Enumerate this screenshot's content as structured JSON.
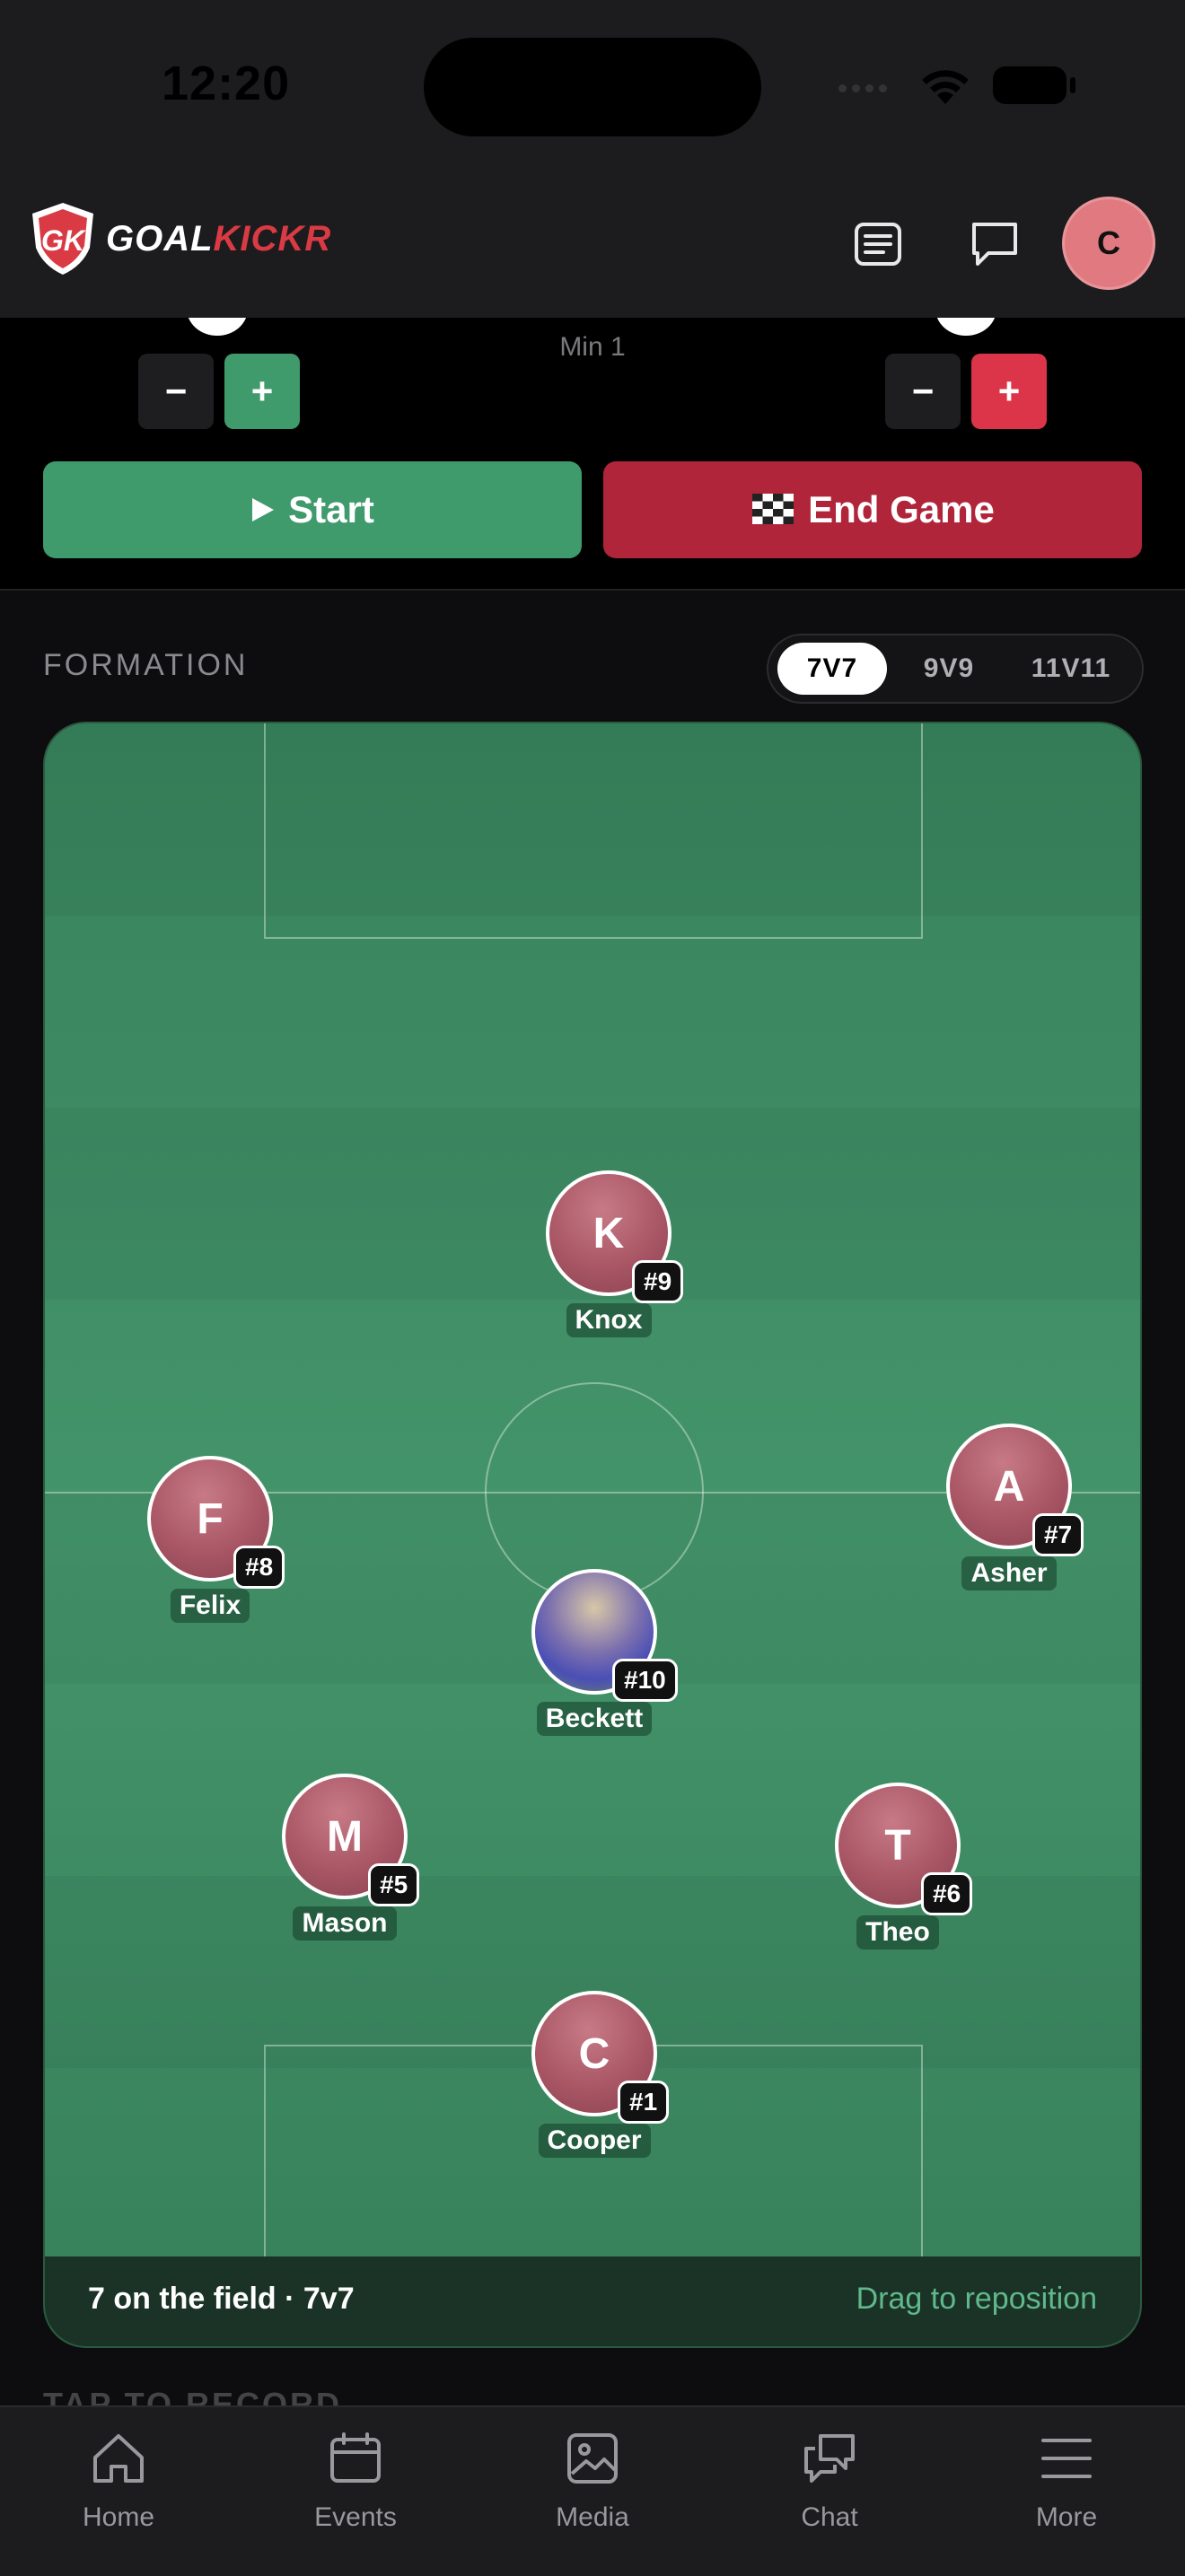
{
  "status_bar": {
    "time": "12:20"
  },
  "header": {
    "brand_part1": "GOAL",
    "brand_part2": "KICKR",
    "avatar_initial": "C"
  },
  "scoreboard": {
    "minute_label": "Min 1",
    "minus_label": "−",
    "plus_label": "+",
    "start_label": "Start",
    "end_label": "End Game"
  },
  "formation": {
    "label": "FORMATION",
    "options": [
      "7V7",
      "9V9",
      "11V11"
    ],
    "selected": "7V7"
  },
  "players": [
    {
      "initial": "K",
      "number": "#9",
      "name": "Knox"
    },
    {
      "initial": "F",
      "number": "#8",
      "name": "Felix"
    },
    {
      "initial": "A",
      "number": "#7",
      "name": "Asher"
    },
    {
      "initial": "",
      "number": "#10",
      "name": "Beckett",
      "has_photo": true
    },
    {
      "initial": "M",
      "number": "#5",
      "name": "Mason"
    },
    {
      "initial": "T",
      "number": "#6",
      "name": "Theo"
    },
    {
      "initial": "C",
      "number": "#1",
      "name": "Cooper"
    }
  ],
  "pitch_footer": {
    "count_text": "7 on the field · 7v7",
    "hint": "Drag to reposition"
  },
  "section_peek": "TAP TO RECORD",
  "tabs": [
    {
      "label": "Home",
      "icon": "home-icon"
    },
    {
      "label": "Events",
      "icon": "calendar-icon"
    },
    {
      "label": "Media",
      "icon": "image-icon"
    },
    {
      "label": "Chat",
      "icon": "chat-icon"
    },
    {
      "label": "More",
      "icon": "menu-icon"
    }
  ],
  "colors": {
    "accent_green": "#3f9a6c",
    "accent_red": "#b0253a",
    "brand_red": "#d93a43",
    "avatar": "#e07a80"
  }
}
